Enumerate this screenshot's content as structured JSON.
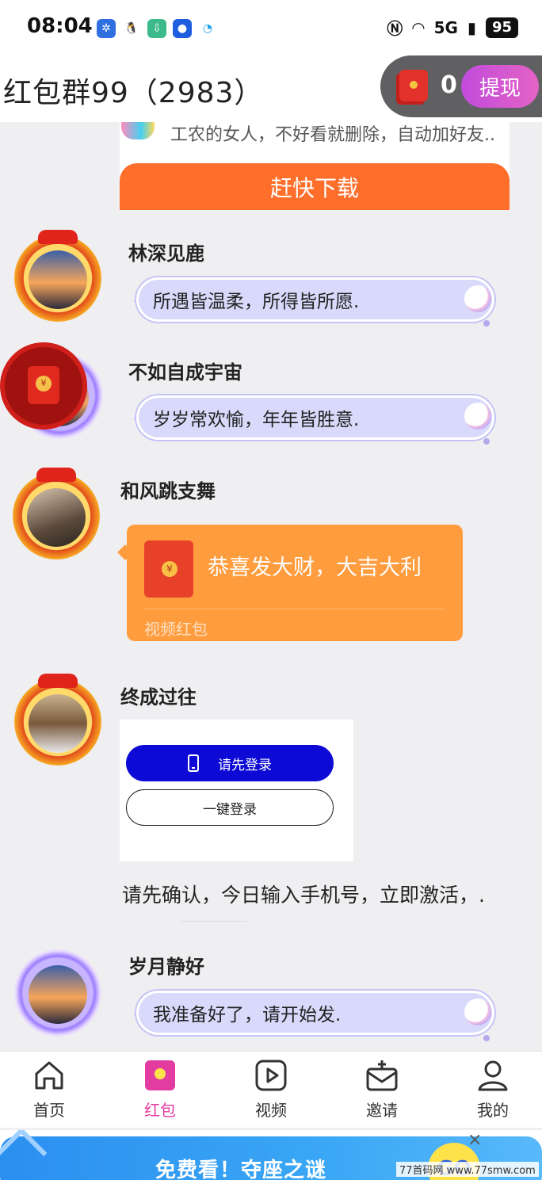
{
  "status_bar": {
    "time": "08:04",
    "signal": "5G",
    "battery": "95",
    "icons": [
      "pinwheel-app-icon",
      "qq-penguin-icon",
      "download-app-icon",
      "browser-app-icon",
      "sync-app-icon",
      "nfc-icon",
      "wifi-icon",
      "signal-icon"
    ]
  },
  "header": {
    "title": "红包群99（2983）",
    "wallet_count": "0",
    "withdraw_label": "提现"
  },
  "ad": {
    "description": "工农的女人，不好看就删除，自动加好友..",
    "download_label": "赶快下载"
  },
  "messages": [
    {
      "sender": "林深见鹿",
      "text": "所遇皆温柔，所得皆所愿."
    },
    {
      "sender": "不如自成宇宙",
      "text": "岁岁常欢愉，年年皆胜意."
    },
    {
      "sender": "和风跳支舞",
      "red_packet_title": "恭喜发大财，大吉大利",
      "red_packet_type": "视频红包"
    },
    {
      "sender": "终成过往",
      "login_primary": "请先登录",
      "login_secondary": "一键登录",
      "text": "请先确认，今日输入手机号，立即激活，."
    },
    {
      "sender": "岁月静好",
      "text": "我准备好了，请开始发."
    }
  ],
  "nav": {
    "items": [
      {
        "label": "首页",
        "icon": "home-icon"
      },
      {
        "label": "红包",
        "icon": "red-packet-icon",
        "active": true
      },
      {
        "label": "视频",
        "icon": "video-icon"
      },
      {
        "label": "邀请",
        "icon": "invite-icon"
      },
      {
        "label": "我的",
        "icon": "profile-icon"
      }
    ]
  },
  "banner": {
    "text": "免费看！夺座之谜",
    "go_label": "GO",
    "close": "×",
    "watermark": "77首码网 www.77smw.com"
  },
  "colors": {
    "accent": "#e23ca0",
    "bubble": "#d9dafb",
    "red_packet_card": "#ff9c3d",
    "download": "#ff6e2a"
  }
}
